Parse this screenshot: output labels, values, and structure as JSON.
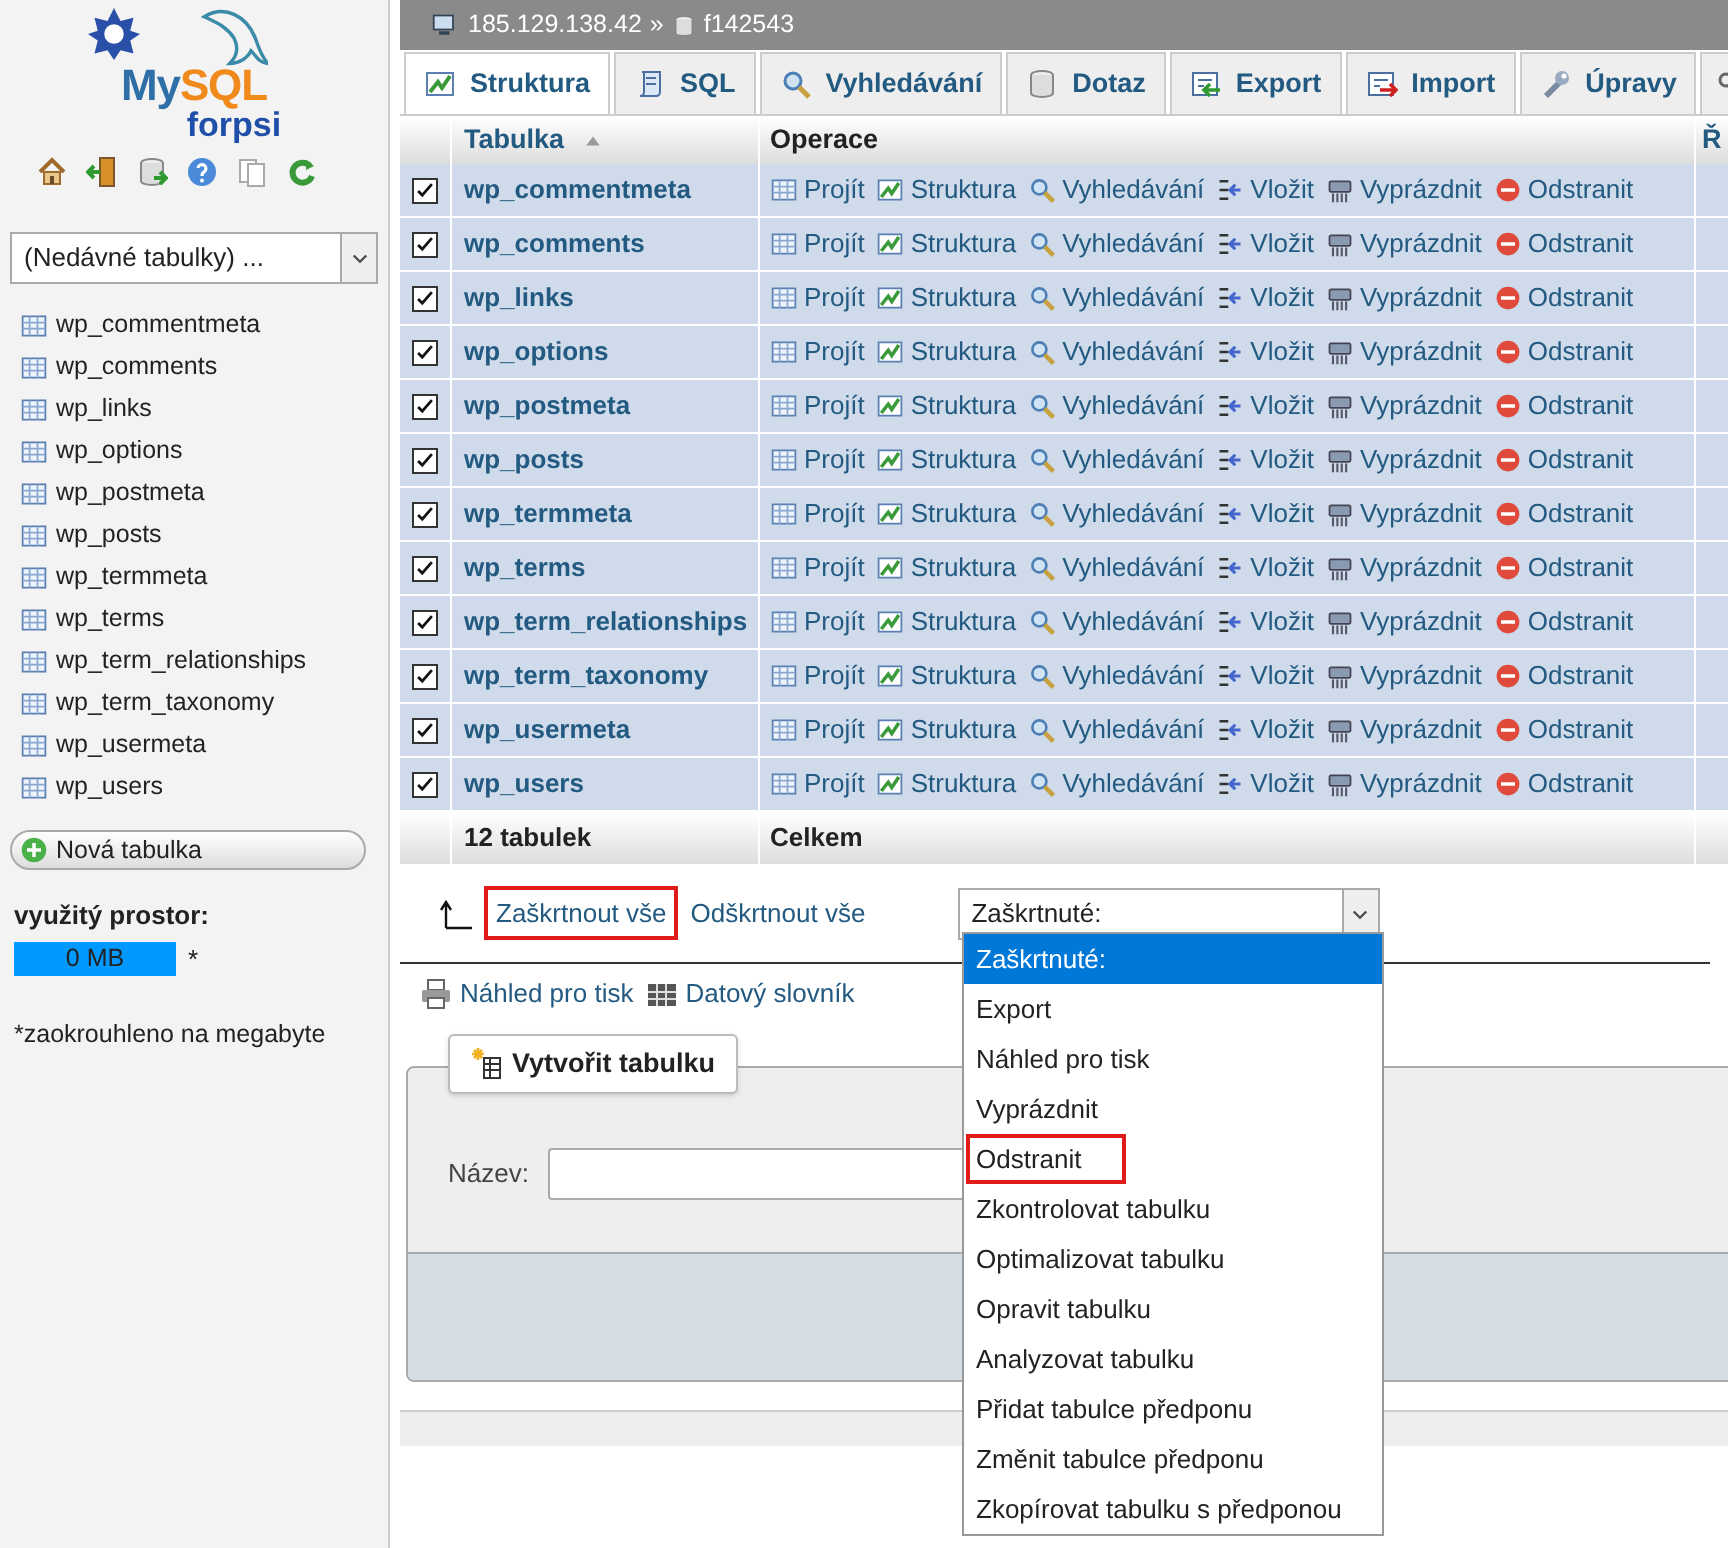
{
  "header": {
    "server": "185.129.138.42",
    "separator": "»",
    "database": "f142543"
  },
  "sidebar": {
    "logo": {
      "my": "My",
      "sql": "SQL",
      "brand": "forpsi"
    },
    "recent_select": "(Nedávné tabulky) ...",
    "tables": [
      "wp_commentmeta",
      "wp_comments",
      "wp_links",
      "wp_options",
      "wp_postmeta",
      "wp_posts",
      "wp_termmeta",
      "wp_terms",
      "wp_term_relationships",
      "wp_term_taxonomy",
      "wp_usermeta",
      "wp_users"
    ],
    "new_table_button": "Nová tabulka",
    "usage": {
      "label": "využitý prostor:",
      "value": "0 MB",
      "note_mark": "*"
    },
    "footnote": "*zaokrouhleno na megabyte"
  },
  "tabs": [
    {
      "label": "Struktura",
      "selected": true
    },
    {
      "label": "SQL",
      "selected": false
    },
    {
      "label": "Vyhledávání",
      "selected": false
    },
    {
      "label": "Dotaz",
      "selected": false
    },
    {
      "label": "Export",
      "selected": false
    },
    {
      "label": "Import",
      "selected": false
    },
    {
      "label": "Úpravy",
      "selected": false
    }
  ],
  "table": {
    "columns": [
      "Tabulka",
      "Operace",
      "Ř"
    ],
    "rows": [
      {
        "name": "wp_commentmeta",
        "checked": true,
        "actions": [
          "Projít",
          "Struktura",
          "Vyhledávání",
          "Vložit",
          "Vyprázdnit",
          "Odstranit"
        ]
      },
      {
        "name": "wp_comments",
        "checked": true,
        "actions": [
          "Projít",
          "Struktura",
          "Vyhledávání",
          "Vložit",
          "Vyprázdnit",
          "Odstranit"
        ]
      },
      {
        "name": "wp_links",
        "checked": true,
        "actions": [
          "Projít",
          "Struktura",
          "Vyhledávání",
          "Vložit",
          "Vyprázdnit",
          "Odstranit"
        ]
      },
      {
        "name": "wp_options",
        "checked": true,
        "actions": [
          "Projít",
          "Struktura",
          "Vyhledávání",
          "Vložit",
          "Vyprázdnit",
          "Odstranit"
        ]
      },
      {
        "name": "wp_postmeta",
        "checked": true,
        "actions": [
          "Projít",
          "Struktura",
          "Vyhledávání",
          "Vložit",
          "Vyprázdnit",
          "Odstranit"
        ]
      },
      {
        "name": "wp_posts",
        "checked": true,
        "actions": [
          "Projít",
          "Struktura",
          "Vyhledávání",
          "Vložit",
          "Vyprázdnit",
          "Odstranit"
        ]
      },
      {
        "name": "wp_termmeta",
        "checked": true,
        "actions": [
          "Projít",
          "Struktura",
          "Vyhledávání",
          "Vložit",
          "Vyprázdnit",
          "Odstranit"
        ]
      },
      {
        "name": "wp_terms",
        "checked": true,
        "actions": [
          "Projít",
          "Struktura",
          "Vyhledávání",
          "Vložit",
          "Vyprázdnit",
          "Odstranit"
        ]
      },
      {
        "name": "wp_term_relationships",
        "checked": true,
        "actions": [
          "Projít",
          "Struktura",
          "Vyhledávání",
          "Vložit",
          "Vyprázdnit",
          "Odstranit"
        ]
      },
      {
        "name": "wp_term_taxonomy",
        "checked": true,
        "actions": [
          "Projít",
          "Struktura",
          "Vyhledávání",
          "Vložit",
          "Vyprázdnit",
          "Odstranit"
        ]
      },
      {
        "name": "wp_usermeta",
        "checked": true,
        "actions": [
          "Projít",
          "Struktura",
          "Vyhledávání",
          "Vložit",
          "Vyprázdnit",
          "Odstranit"
        ]
      },
      {
        "name": "wp_users",
        "checked": true,
        "actions": [
          "Projít",
          "Struktura",
          "Vyhledávání",
          "Vložit",
          "Vyprázdnit",
          "Odstranit"
        ]
      }
    ],
    "footer": [
      "12 tabulek",
      "Celkem"
    ]
  },
  "check_all": {
    "check": {
      "label": "Zaškrtnout vše",
      "highlighted": true
    },
    "uncheck": {
      "label": "Odškrtnout vše",
      "highlighted": false
    }
  },
  "with_selected": {
    "value": "Zaškrtnuté:",
    "options": [
      {
        "label": "Zaškrtnuté:",
        "selected": true,
        "highlighted": false
      },
      {
        "label": "Export",
        "selected": false,
        "highlighted": false
      },
      {
        "label": "Náhled pro tisk",
        "selected": false,
        "highlighted": false
      },
      {
        "label": "Vyprázdnit",
        "selected": false,
        "highlighted": false
      },
      {
        "label": "Odstranit",
        "selected": false,
        "highlighted": true
      },
      {
        "label": "Zkontrolovat tabulku",
        "selected": false,
        "highlighted": false
      },
      {
        "label": "Optimalizovat tabulku",
        "selected": false,
        "highlighted": false
      },
      {
        "label": "Opravit tabulku",
        "selected": false,
        "highlighted": false
      },
      {
        "label": "Analyzovat tabulku",
        "selected": false,
        "highlighted": false
      },
      {
        "label": "Přidat tabulce předponu",
        "selected": false,
        "highlighted": false
      },
      {
        "label": "Změnit tabulce předponu",
        "selected": false,
        "highlighted": false
      },
      {
        "label": "Zkopírovat tabulku s předponou",
        "selected": false,
        "highlighted": false
      }
    ]
  },
  "links": [
    "Náhled pro tisk",
    "Datový slovník"
  ],
  "create_table": {
    "legend": "Vytvořit tabulku",
    "name_label": "Název:"
  }
}
